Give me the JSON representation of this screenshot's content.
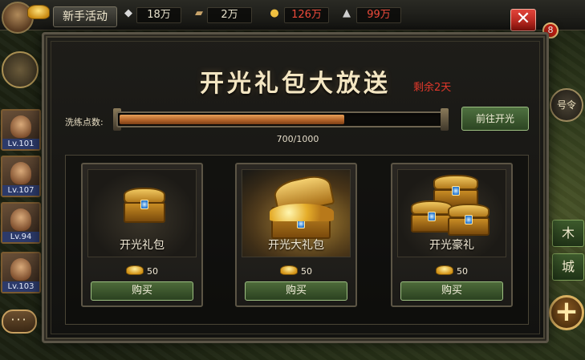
{
  "topbar": {
    "event_button": "新手活动",
    "resources": [
      {
        "icon": "silver-icon",
        "value": "18万"
      },
      {
        "icon": "wood-icon",
        "value": "2万"
      },
      {
        "icon": "gold-icon",
        "value": "126万"
      },
      {
        "icon": "soldier-icon",
        "value": "99万"
      }
    ],
    "close_glyph": "✕",
    "notification_count": "8"
  },
  "heroes": [
    {
      "level": "Lv.101"
    },
    {
      "level": "Lv.107"
    },
    {
      "level": "Lv.94"
    },
    {
      "level": "Lv.103"
    }
  ],
  "right_sidebar": {
    "order_label": "号令",
    "wood_label": "木",
    "city_label": "城",
    "plus_glyph": "+"
  },
  "chat_glyph": "···",
  "dialog": {
    "title": "开光礼包大放送",
    "remaining": "剩余2天",
    "progress_label": "洗练点数:",
    "progress_text": "700/1000",
    "progress": {
      "current": 700,
      "max": 1000
    },
    "goto_button": "前往开光",
    "packs": [
      {
        "name": "开光礼包",
        "price": "50",
        "buy_label": "购买"
      },
      {
        "name": "开光大礼包",
        "price": "50",
        "buy_label": "购买"
      },
      {
        "name": "开光豪礼",
        "price": "50",
        "buy_label": "购买"
      }
    ]
  },
  "colors": {
    "remaining_red": "#e0382b",
    "progress_orange": "#b5652a",
    "buy_green": "#4e6b3a",
    "close_red": "#c0231a"
  }
}
